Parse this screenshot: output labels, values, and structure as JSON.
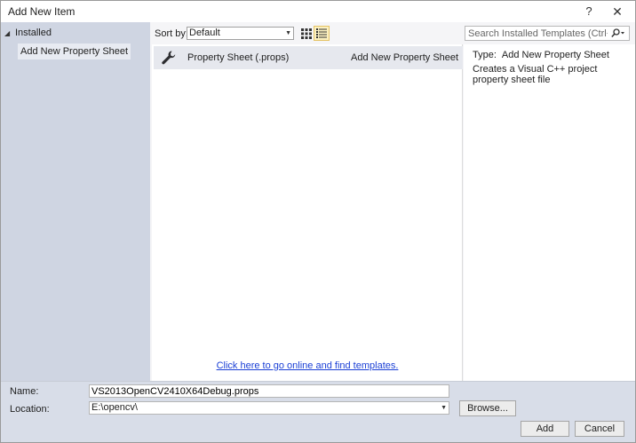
{
  "window": {
    "title": "Add New Item",
    "help_label": "?",
    "close_label": "✕"
  },
  "tree": {
    "root_label": "Installed",
    "items": [
      {
        "label": "Add New Property Sheet"
      }
    ]
  },
  "toolbar": {
    "sort_label": "Sort by:",
    "sort_value": "Default",
    "search_placeholder": "Search Installed Templates (Ctrl+E)"
  },
  "templates": [
    {
      "name": "Property Sheet (.props)",
      "category": "Add New Property Sheet",
      "icon": "wrench-icon"
    }
  ],
  "online_link": "Click here to go online and find templates.",
  "details": {
    "type_key": "Type:",
    "type_value": "Add New Property Sheet",
    "description": "Creates a Visual C++ project property sheet file"
  },
  "form": {
    "name_label": "Name:",
    "name_value": "VS2013OpenCV2410X64Debug.props",
    "location_label": "Location:",
    "location_value": "E:\\opencv\\",
    "browse_label": "Browse...",
    "add_label": "Add",
    "cancel_label": "Cancel"
  },
  "colors": {
    "link": "#1a3fd6",
    "left_pane": "#cfd5e2",
    "bottom_bar": "#d8dde8",
    "selected_view": "#fbf0c0"
  }
}
